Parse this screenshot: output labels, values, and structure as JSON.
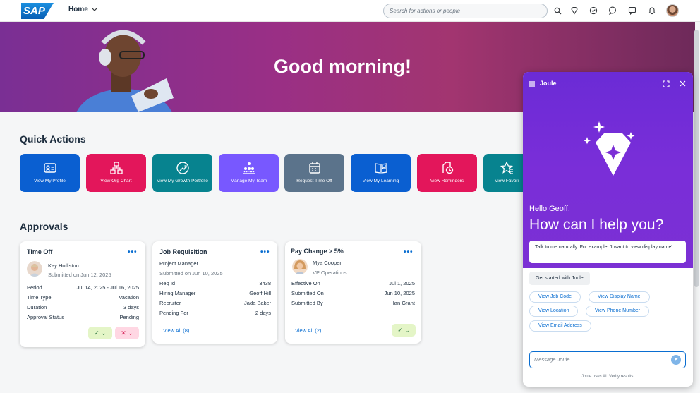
{
  "shell": {
    "logo_text": "SAP",
    "home_label": "Home",
    "search_placeholder": "Search for actions or people",
    "icons": [
      "search-icon",
      "diamond-icon",
      "check-circle-icon",
      "chat-help-icon",
      "feedback-icon",
      "bell-icon"
    ]
  },
  "banner": {
    "greeting": "Good morning!"
  },
  "quick_actions": {
    "title": "Quick Actions",
    "tiles": [
      {
        "label": "View My Profile",
        "color": "#0a5fd1",
        "icon": "profile-card-icon"
      },
      {
        "label": "View Org Chart",
        "color": "#e3165b",
        "icon": "org-chart-icon"
      },
      {
        "label": "View My Growth Portfolio",
        "color": "#07838f",
        "icon": "growth-icon"
      },
      {
        "label": "Manage My Team",
        "color": "#7858ff",
        "icon": "team-icon"
      },
      {
        "label": "Request Time Off",
        "color": "#5b738b",
        "icon": "calendar-icon"
      },
      {
        "label": "View My Learning",
        "color": "#0a5fd1",
        "icon": "book-icon"
      },
      {
        "label": "View Reminders",
        "color": "#e3165b",
        "icon": "reminder-icon"
      },
      {
        "label": "View Favori",
        "color": "#07838f",
        "icon": "favorite-icon"
      }
    ]
  },
  "approvals": {
    "title": "Approvals",
    "time_off": {
      "title": "Time Off",
      "more": "•••",
      "person": "Kay Holliston",
      "submitted": "Submitted on Jun 12, 2025",
      "rows": [
        {
          "label": "Period",
          "value": "Jul 14, 2025 - Jul 16, 2025"
        },
        {
          "label": "Time Type",
          "value": "Vacation"
        },
        {
          "label": "Duration",
          "value": "3 days"
        },
        {
          "label": "Approval Status",
          "value": "Pending"
        }
      ],
      "approve": "✓ ⌄",
      "reject": "✕ ⌄"
    },
    "job_req": {
      "title": "Job Requisition",
      "more": "•••",
      "subtitle": "Project Manager",
      "submitted": "Submitted on Jun 10, 2025",
      "rows": [
        {
          "label": "Req Id",
          "value": "3438"
        },
        {
          "label": "Hiring Manager",
          "value": "Geoff Hill"
        },
        {
          "label": "Recruiter",
          "value": "Jada Baker"
        },
        {
          "label": "Pending For",
          "value": "2 days"
        }
      ],
      "view_all": "View All (8)"
    },
    "pay_change": {
      "title": "Pay Change > 5%",
      "more": "•••",
      "person": "Mya Cooper",
      "role": "VP Operations",
      "rows": [
        {
          "label": "Effective On",
          "value": "Jul 1, 2025"
        },
        {
          "label": "Submitted On",
          "value": "Jun 10, 2025"
        },
        {
          "label": "Submitted By",
          "value": "Ian Grant"
        }
      ],
      "view_all": "View All (2)",
      "approve": "✓ ⌄"
    }
  },
  "joule": {
    "title": "Joule",
    "hello": "Hello Geoff,",
    "help": "How can I help you?",
    "hint": "Talk to me naturally. For example, 'I want to view display name'",
    "get_started": "Get started with Joule",
    "chips": [
      "View Job Code",
      "View Display Name",
      "View Location",
      "View Phone Number",
      "View Email Address"
    ],
    "message_placeholder": "Message Joule...",
    "disclaimer": "Joule uses AI. Verify results."
  }
}
